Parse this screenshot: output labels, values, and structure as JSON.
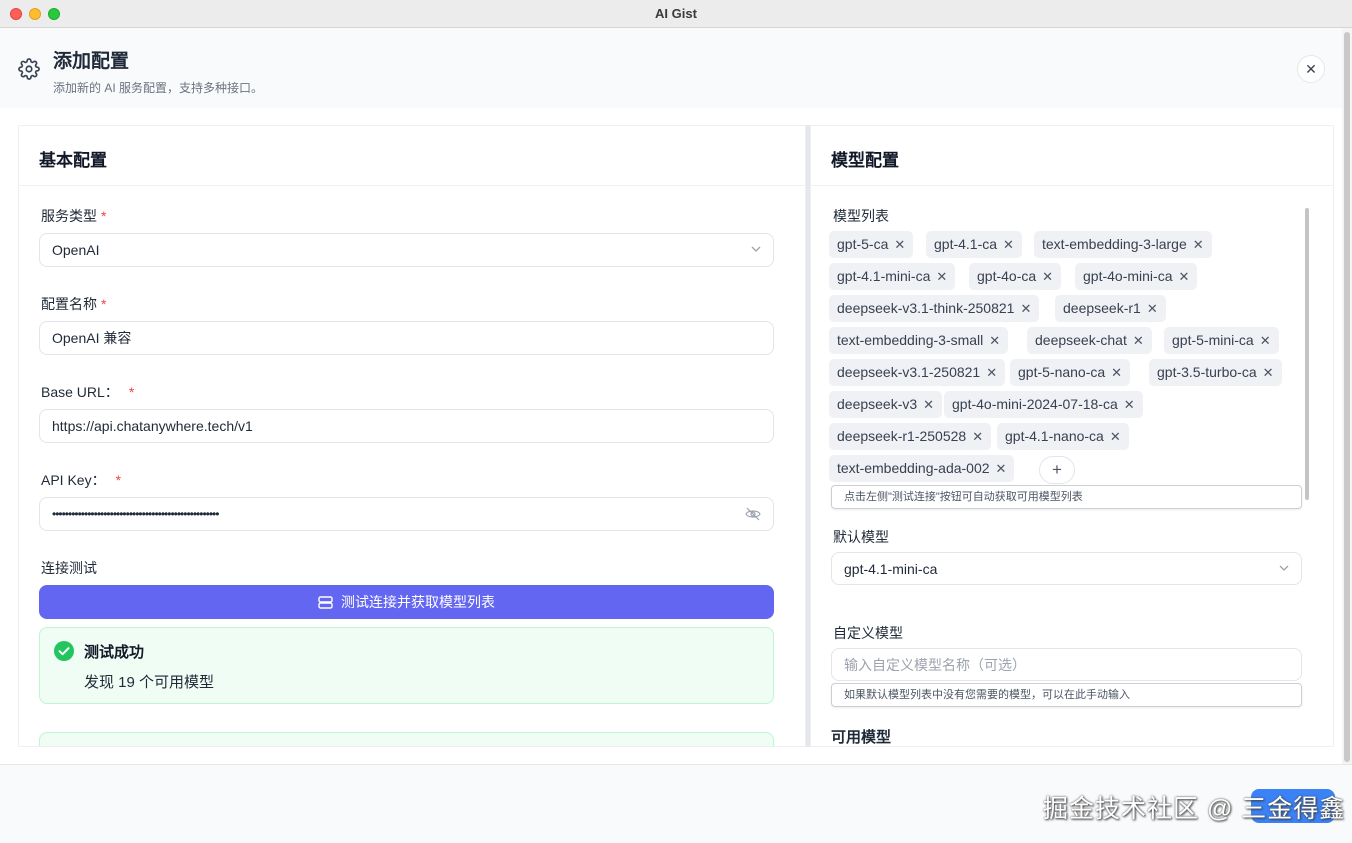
{
  "window": {
    "title": "AI Gist"
  },
  "dialog": {
    "title": "添加配置",
    "subtitle": "添加新的 AI 服务配置，支持多种接口。",
    "close_glyph": "✕"
  },
  "basic": {
    "title": "基本配置",
    "service_type": {
      "label": "服务类型",
      "required": "*",
      "value": "OpenAI"
    },
    "config_name": {
      "label": "配置名称",
      "required": "*",
      "value": "OpenAI 兼容"
    },
    "base_url": {
      "label": "Base URL：",
      "required": "*",
      "value": "https://api.chatanywhere.tech/v1"
    },
    "api_key": {
      "label": "API Key：",
      "required": "*",
      "value": "••••••••••••••••••••••••••••••••••••••••••••••••••••"
    },
    "connection": {
      "label": "连接测试",
      "button_label": "测试连接并获取模型列表",
      "success_title": "测试成功",
      "success_message": "发现 19 个可用模型"
    }
  },
  "models": {
    "title": "模型配置",
    "list_label": "模型列表",
    "tags": [
      "gpt-5-ca",
      "gpt-4.1-ca",
      "text-embedding-3-large",
      "gpt-4.1-mini-ca",
      "gpt-4o-ca",
      "gpt-4o-mini-ca",
      "deepseek-v3.1-think-250821",
      "deepseek-r1",
      "text-embedding-3-small",
      "deepseek-chat",
      "gpt-5-mini-ca",
      "deepseek-v3.1-250821",
      "gpt-5-nano-ca",
      "gpt-3.5-turbo-ca",
      "deepseek-v3",
      "gpt-4o-mini-2024-07-18-ca",
      "deepseek-r1-250528",
      "gpt-4.1-nano-ca",
      "text-embedding-ada-002"
    ],
    "remove_glyph": "✕",
    "add_glyph": "+",
    "list_hint": "点击左侧\"测试连接\"按钮可自动获取可用模型列表",
    "default_model": {
      "label": "默认模型",
      "value": "gpt-4.1-mini-ca"
    },
    "custom_model": {
      "label": "自定义模型",
      "placeholder": "输入自定义模型名称（可选）",
      "hint": "如果默认模型列表中没有您需要的模型，可以在此手动输入"
    },
    "available_label": "可用模型"
  },
  "watermark": "掘金技术社区 @ 三金得鑫",
  "colors": {
    "primary": "#6366f1",
    "success_bg": "#f0fdf4",
    "success_icon": "#22c55e",
    "required": "#ef4444",
    "save_button": "#3b82f6"
  }
}
